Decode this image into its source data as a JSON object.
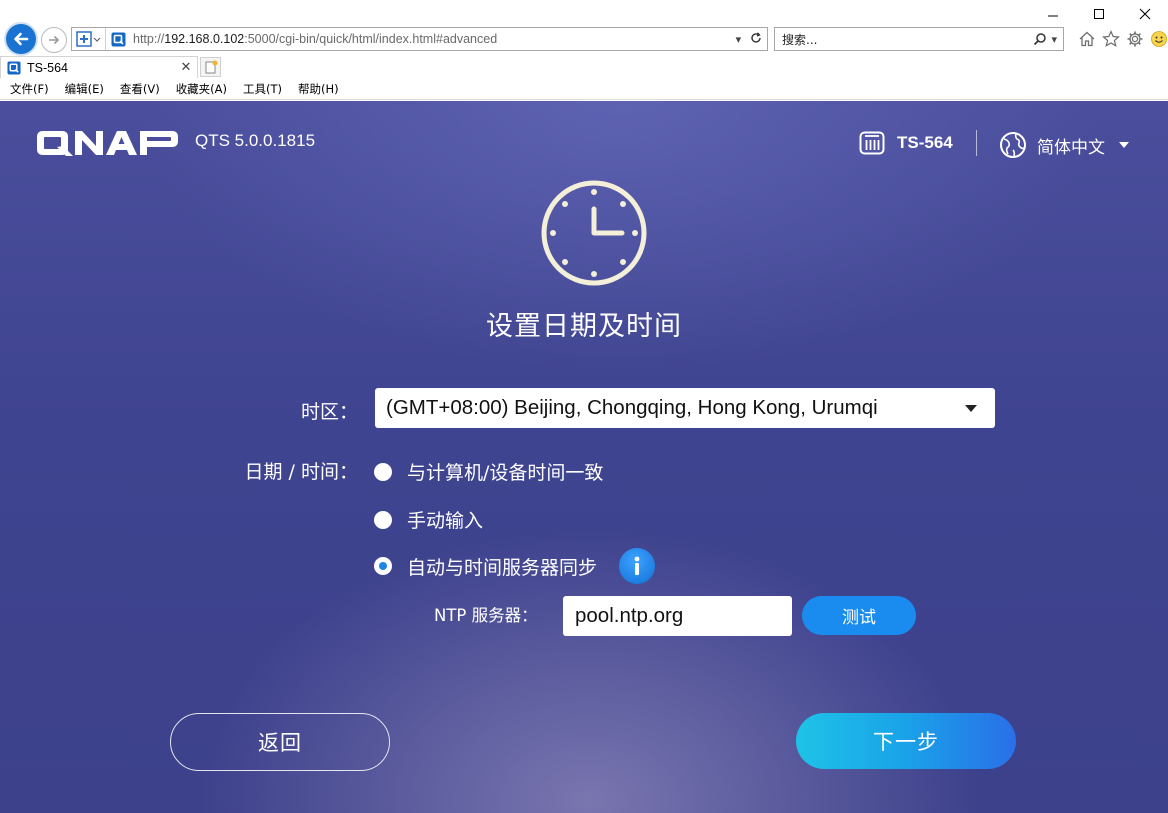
{
  "browser": {
    "url_prefix": "http://",
    "url_host": "192.168.0.102",
    "url_rest": ":5000/cgi-bin/quick/html/index.html#advanced",
    "search_placeholder": "搜索...",
    "tab_title": "TS-564",
    "menu": [
      "文件(F)",
      "编辑(E)",
      "查看(V)",
      "收藏夹(A)",
      "工具(T)",
      "帮助(H)"
    ]
  },
  "header": {
    "brand": "QNAP",
    "version": "QTS 5.0.0.1815",
    "device_name": "TS-564",
    "language": "简体中文"
  },
  "main": {
    "heading": "设置日期及时间",
    "timezone_label": "时区：",
    "timezone_value": "(GMT+08:00) Beijing, Chongqing, Hong Kong, Urumqi",
    "datetime_label": "日期 / 时间：",
    "options": [
      {
        "label": "与计算机/设备时间一致",
        "selected": false
      },
      {
        "label": "手动输入",
        "selected": false
      },
      {
        "label": "自动与时间服务器同步",
        "selected": true
      }
    ],
    "ntp_label": "NTP 服务器：",
    "ntp_value": "pool.ntp.org",
    "test_button": "测试"
  },
  "footer": {
    "back_button": "返回",
    "next_button": "下一步"
  },
  "colors": {
    "accent": "#1a8cf0",
    "background": "#3f4490"
  }
}
